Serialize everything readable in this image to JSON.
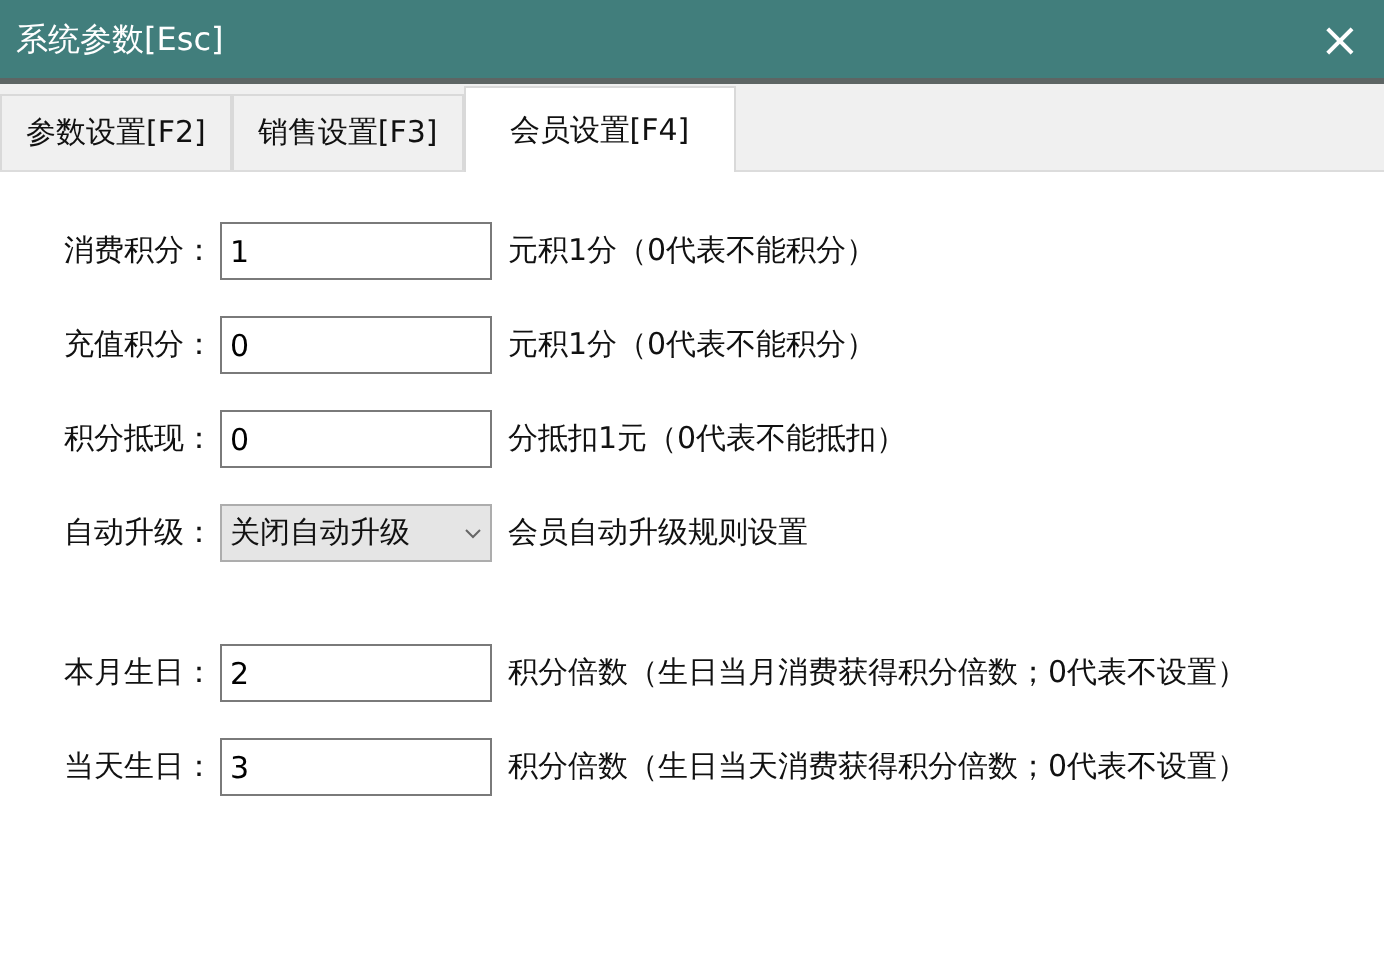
{
  "window": {
    "title": "系统参数[Esc]",
    "close": "×"
  },
  "tabs": [
    {
      "label": "参数设置[F2]",
      "selected": false
    },
    {
      "label": "销售设置[F3]",
      "selected": false
    },
    {
      "label": "会员设置[F4]",
      "selected": true
    }
  ],
  "fields": [
    {
      "kind": "input",
      "label": "消费积分：",
      "value": "1",
      "note": "元积1分（0代表不能积分）"
    },
    {
      "kind": "input",
      "label": "充值积分：",
      "value": "0",
      "note": "元积1分（0代表不能积分）"
    },
    {
      "kind": "input",
      "label": "积分抵现：",
      "value": "0",
      "note": "分抵扣1元（0代表不能抵扣）"
    },
    {
      "kind": "select",
      "label": "自动升级：",
      "value": "关闭自动升级",
      "note": "会员自动升级规则设置"
    },
    {
      "kind": "spacer"
    },
    {
      "kind": "input",
      "label": "本月生日：",
      "value": "2",
      "note": "积分倍数（生日当月消费获得积分倍数；0代表不设置）"
    },
    {
      "kind": "input",
      "label": "当天生日：",
      "value": "3",
      "note": "积分倍数（生日当天消费获得积分倍数；0代表不设置）"
    }
  ]
}
